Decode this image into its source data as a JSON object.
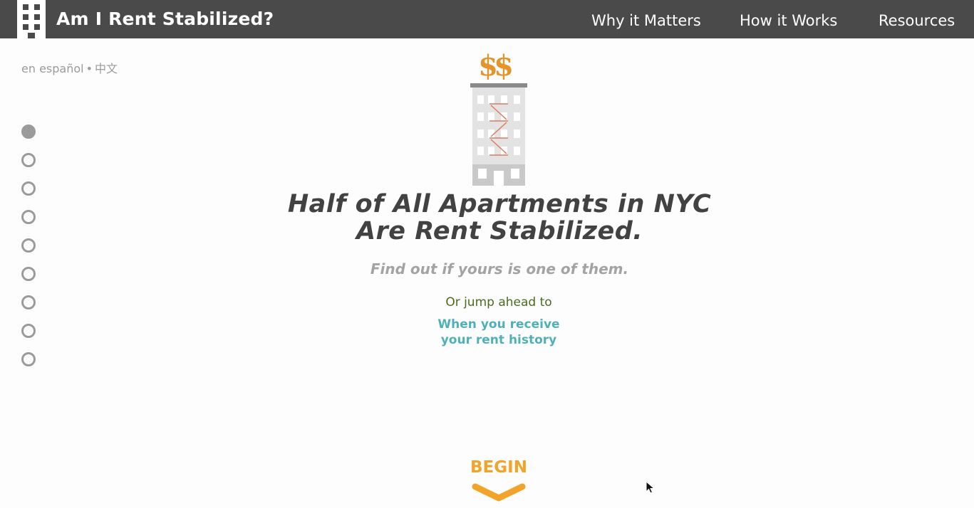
{
  "header": {
    "title": "Am I Rent Stabilized?",
    "nav": [
      "Why it Matters",
      "How it Works",
      "Resources"
    ]
  },
  "languages": {
    "spanish": "en español",
    "separator": "•",
    "chinese": "中文"
  },
  "progress": {
    "total_steps": 9,
    "current_step": 1
  },
  "hero": {
    "headline_line1": "Half of All Apartments in NYC",
    "headline_line2": "Are Rent Stabilized.",
    "subhead": "Find out if yours is one of them.",
    "jump_label": "Or jump ahead to",
    "jump_link_line1": "When you receive",
    "jump_link_line2": "your rent history"
  },
  "begin": {
    "label": "BEGIN",
    "icon": "chevron-down-icon"
  },
  "colors": {
    "header_bg": "#4a4a4a",
    "accent_orange": "#f2a42a",
    "link_teal": "#4fb1b7",
    "dollar": "#e3952b",
    "fire_escape": "#e07a5f",
    "text_dark": "#424242",
    "muted": "#9b9b9b"
  }
}
